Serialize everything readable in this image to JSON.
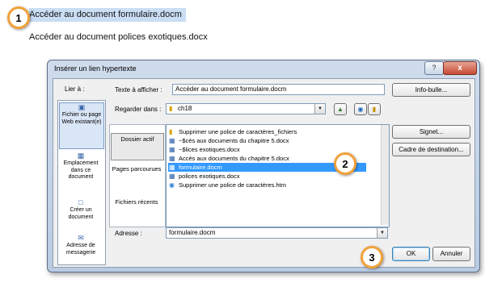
{
  "document": {
    "line1": "Accéder au document formulaire.docm",
    "line2": "Accéder au document polices exotiques.docx"
  },
  "callouts": [
    "1",
    "2",
    "3"
  ],
  "dialog": {
    "title": "Insérer un lien hypertexte",
    "help_label": "?",
    "close_label": "x",
    "link_to_label": "Lier à :",
    "link_to": [
      {
        "label": "Fichier ou page Web existant(e)",
        "icon": "web-page-icon",
        "selected": true
      },
      {
        "label": "Emplacement dans ce document",
        "icon": "document-location-icon"
      },
      {
        "label": "Créer un document",
        "icon": "new-document-icon"
      },
      {
        "label": "Adresse de messagerie",
        "icon": "email-icon"
      }
    ],
    "text_to_display_label": "Texte à afficher :",
    "text_to_display_value": "Accéder au document formulaire.docm",
    "screentip_button": "Info-bulle...",
    "look_in_label": "Regarder dans :",
    "look_in_value": "ch18",
    "look_in_tabs": [
      {
        "label": "Dossier actif",
        "selected": true
      },
      {
        "label": "Pages parcourues"
      },
      {
        "label": "Fichiers récents"
      }
    ],
    "files": [
      {
        "name": "Supprimer une police de caractères_fichiers",
        "icon": "folder-icon"
      },
      {
        "name": "~$cès aux documents du chapitre 5.docx",
        "icon": "word-doc-icon"
      },
      {
        "name": "~$lices exotiques.docx",
        "icon": "word-doc-icon"
      },
      {
        "name": "Accès aux documents du chapitre 5.docx",
        "icon": "word-doc-icon"
      },
      {
        "name": "formulaire.docm",
        "icon": "word-doc-icon",
        "selected": true
      },
      {
        "name": "polices exotiques.docx",
        "icon": "word-doc-icon"
      },
      {
        "name": "Supprimer une police de caractères.htm",
        "icon": "html-page-icon"
      }
    ],
    "bookmark_button": "Signet...",
    "target_frame_button": "Cadre de destination...",
    "address_label": "Adresse :",
    "address_value": "formulaire.docm",
    "ok_button": "OK",
    "cancel_button": "Annuler"
  }
}
